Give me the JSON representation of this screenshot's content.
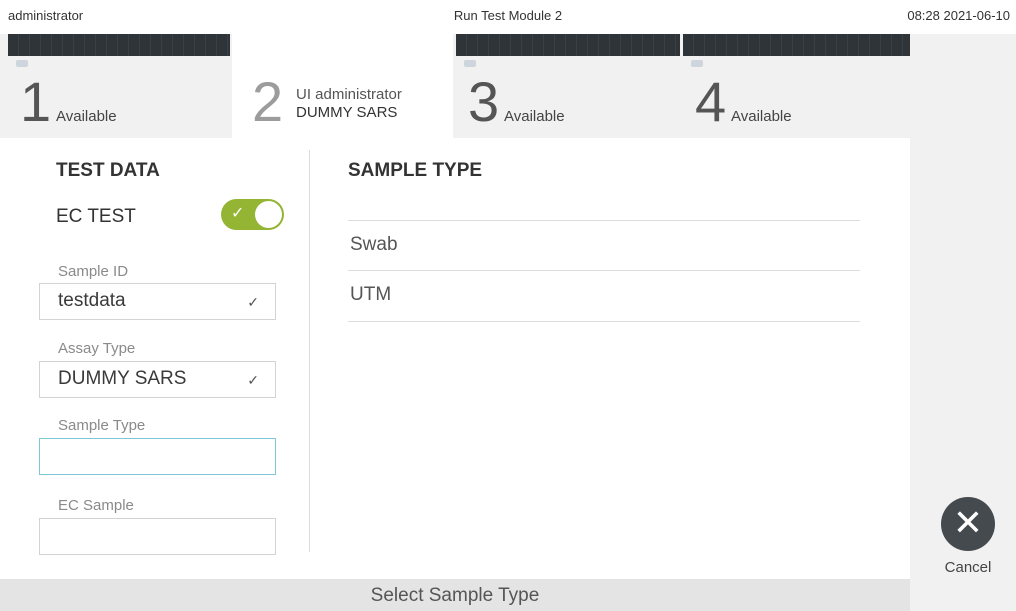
{
  "status_bar": {
    "user": "administrator",
    "title": "Run Test Module 2",
    "datetime": "08:28 2021-06-10"
  },
  "modules": [
    {
      "number": "1",
      "label": "Available"
    },
    {
      "number": "2",
      "line1": "UI administrator",
      "line2": "DUMMY SARS"
    },
    {
      "number": "3",
      "label": "Available"
    },
    {
      "number": "4",
      "label": "Available"
    }
  ],
  "test_data": {
    "heading": "TEST DATA",
    "ec_test_label": "EC TEST",
    "ec_test_on": true,
    "sample_id_label": "Sample ID",
    "sample_id_value": "testdata",
    "assay_type_label": "Assay Type",
    "assay_type_value": "DUMMY SARS",
    "sample_type_label": "Sample Type",
    "sample_type_value": "",
    "ec_sample_label": "EC Sample",
    "ec_sample_value": ""
  },
  "sample_type_panel": {
    "heading": "SAMPLE TYPE",
    "options": [
      "Swab",
      "UTM"
    ]
  },
  "cancel": {
    "label": "Cancel",
    "icon": "close-icon"
  },
  "bottom_message": "Select Sample Type",
  "colors": {
    "toggle_on": "#94b434",
    "focus_border": "#7fc6d8",
    "cancel_button": "#454a4f"
  }
}
